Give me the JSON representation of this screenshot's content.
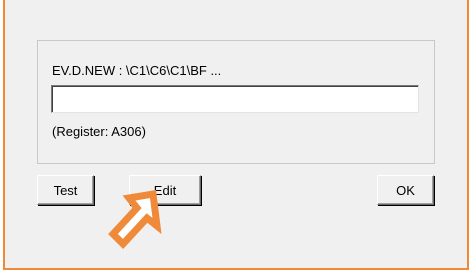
{
  "dialog": {
    "path_label": "EV.D.NEW : \\C1\\C6\\C1\\BF   ...",
    "input_value": "",
    "register_label": "(Register: A306)"
  },
  "buttons": {
    "test_label": "Test",
    "edit_label": "Edit",
    "ok_label": "OK"
  },
  "annotation": {
    "arrow_icon": "arrow-pointer-icon",
    "arrow_color": "#ef8a3a"
  },
  "colors": {
    "frame_border": "#ef8a3a",
    "dialog_bg": "#f0f0f0"
  }
}
